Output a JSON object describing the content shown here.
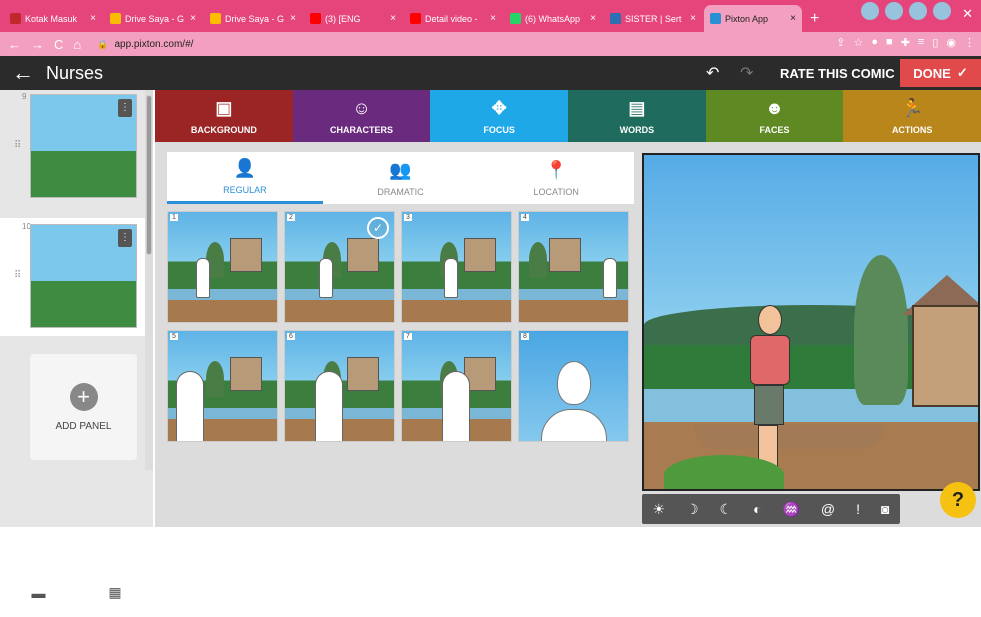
{
  "browser": {
    "tabs": [
      {
        "title": "Kotak Masuk",
        "color": "#c1272d",
        "icon": "gmail-icon"
      },
      {
        "title": "Drive Saya - G",
        "color": "#fbbc04",
        "icon": "drive-icon"
      },
      {
        "title": "Drive Saya - G",
        "color": "#fbbc04",
        "icon": "drive-icon"
      },
      {
        "title": "(3) [ENG",
        "color": "#ff0000",
        "icon": "youtube-icon"
      },
      {
        "title": "Detail video -",
        "color": "#ff0000",
        "icon": "youtube-icon"
      },
      {
        "title": "(6) WhatsApp",
        "color": "#25d366",
        "icon": "whatsapp-icon"
      },
      {
        "title": "SISTER | Sert",
        "color": "#2c6fb3",
        "icon": "sister-icon"
      },
      {
        "title": "Pixton App",
        "color": "#f3a0c0",
        "icon": "pixton-icon",
        "active": true
      }
    ],
    "url": "app.pixton.com/#/"
  },
  "appbar": {
    "title": "Nurses",
    "rate_label": "RATE THIS COMIC",
    "done_label": "DONE"
  },
  "panels": {
    "items": [
      {
        "number": "9"
      },
      {
        "number": "10"
      }
    ],
    "add_label": "ADD PANEL"
  },
  "categories": [
    {
      "label": "BACKGROUND",
      "color": "#9b2424",
      "icon": "image-icon"
    },
    {
      "label": "CHARACTERS",
      "color": "#6a2a7e",
      "icon": "face-icon"
    },
    {
      "label": "FOCUS",
      "color": "#1fa8e8",
      "icon": "move-icon"
    },
    {
      "label": "WORDS",
      "color": "#1f6b5e",
      "icon": "speech-icon"
    },
    {
      "label": "FACES",
      "color": "#5f8a23",
      "icon": "smile-icon"
    },
    {
      "label": "ACTIONS",
      "color": "#b8861b",
      "icon": "run-icon"
    }
  ],
  "focus_tabs": [
    {
      "label": "REGULAR",
      "icon": "person-icon",
      "active": true
    },
    {
      "label": "DRAMATIC",
      "icon": "group-icon"
    },
    {
      "label": "LOCATION",
      "icon": "pin-icon"
    }
  ],
  "thumbs": [
    {
      "n": "1"
    },
    {
      "n": "2",
      "selected": true
    },
    {
      "n": "3"
    },
    {
      "n": "4"
    },
    {
      "n": "5"
    },
    {
      "n": "6"
    },
    {
      "n": "7"
    },
    {
      "n": "8"
    }
  ]
}
